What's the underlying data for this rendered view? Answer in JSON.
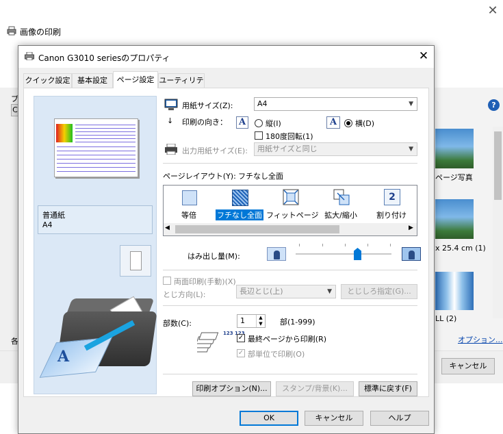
{
  "background_window": {
    "title": "画像の印刷",
    "close_glyph": "✕",
    "right_labels": [
      "ページ写真",
      "x 25.4 cm (1)",
      "LL (2)"
    ],
    "options_link": "オプション...",
    "cancel_label": "キャンセル",
    "help_glyph": "?",
    "left_fragment_1": "プ",
    "left_fragment_2": "C",
    "left_fragment_3": "各"
  },
  "dialog": {
    "title": "Canon G3010 seriesのプロパティ",
    "close_glyph": "✕",
    "tabs": [
      "クイック設定",
      "基本設定",
      "ページ設定",
      "ユーティリティ"
    ],
    "active_tab": "ページ設定",
    "preview": {
      "media_type": "普通紙",
      "media_size": "A4"
    },
    "page_size": {
      "label": "用紙サイズ(Z):",
      "value": "A4"
    },
    "orientation": {
      "label": "印刷の向き：",
      "portrait_icon": "A",
      "portrait_label": "縦(I)",
      "landscape_icon": "A",
      "landscape_label": "横(D)",
      "selected": "landscape",
      "rotate_label": "180度回転(1)"
    },
    "output_size": {
      "label": "出力用紙サイズ(E):",
      "value": "用紙サイズと同じ"
    },
    "page_layout": {
      "label": "ページレイアウト(Y):",
      "current": "フチなし全面",
      "items": [
        "等倍",
        "フチなし全面",
        "フィットページ",
        "拡大/縮小",
        "割り付け"
      ],
      "selected": "フチなし全面",
      "layout_number": "2"
    },
    "overhang": {
      "label": "はみ出し量(M):"
    },
    "duplex": {
      "label": "両面印刷(手動)(X)",
      "binding_label": "とじ方向(L):",
      "binding_value": "長辺とじ(上)",
      "margin_button": "とじしろ指定(G)..."
    },
    "copies": {
      "label": "部数(C):",
      "value": "1",
      "range": "部(1-999)",
      "reverse_label": "最終ページから印刷(R)",
      "reverse_checked": true,
      "collate_label": "部単位で印刷(O)",
      "collate_checked": true,
      "icon_numbers": "123 123"
    },
    "buttons": {
      "print_options": "印刷オプション(N)...",
      "stamp": "スタンプ/背景(K)...",
      "defaults": "標準に戻す(F)",
      "ok": "OK",
      "cancel": "キャンセル",
      "help": "ヘルプ"
    }
  }
}
